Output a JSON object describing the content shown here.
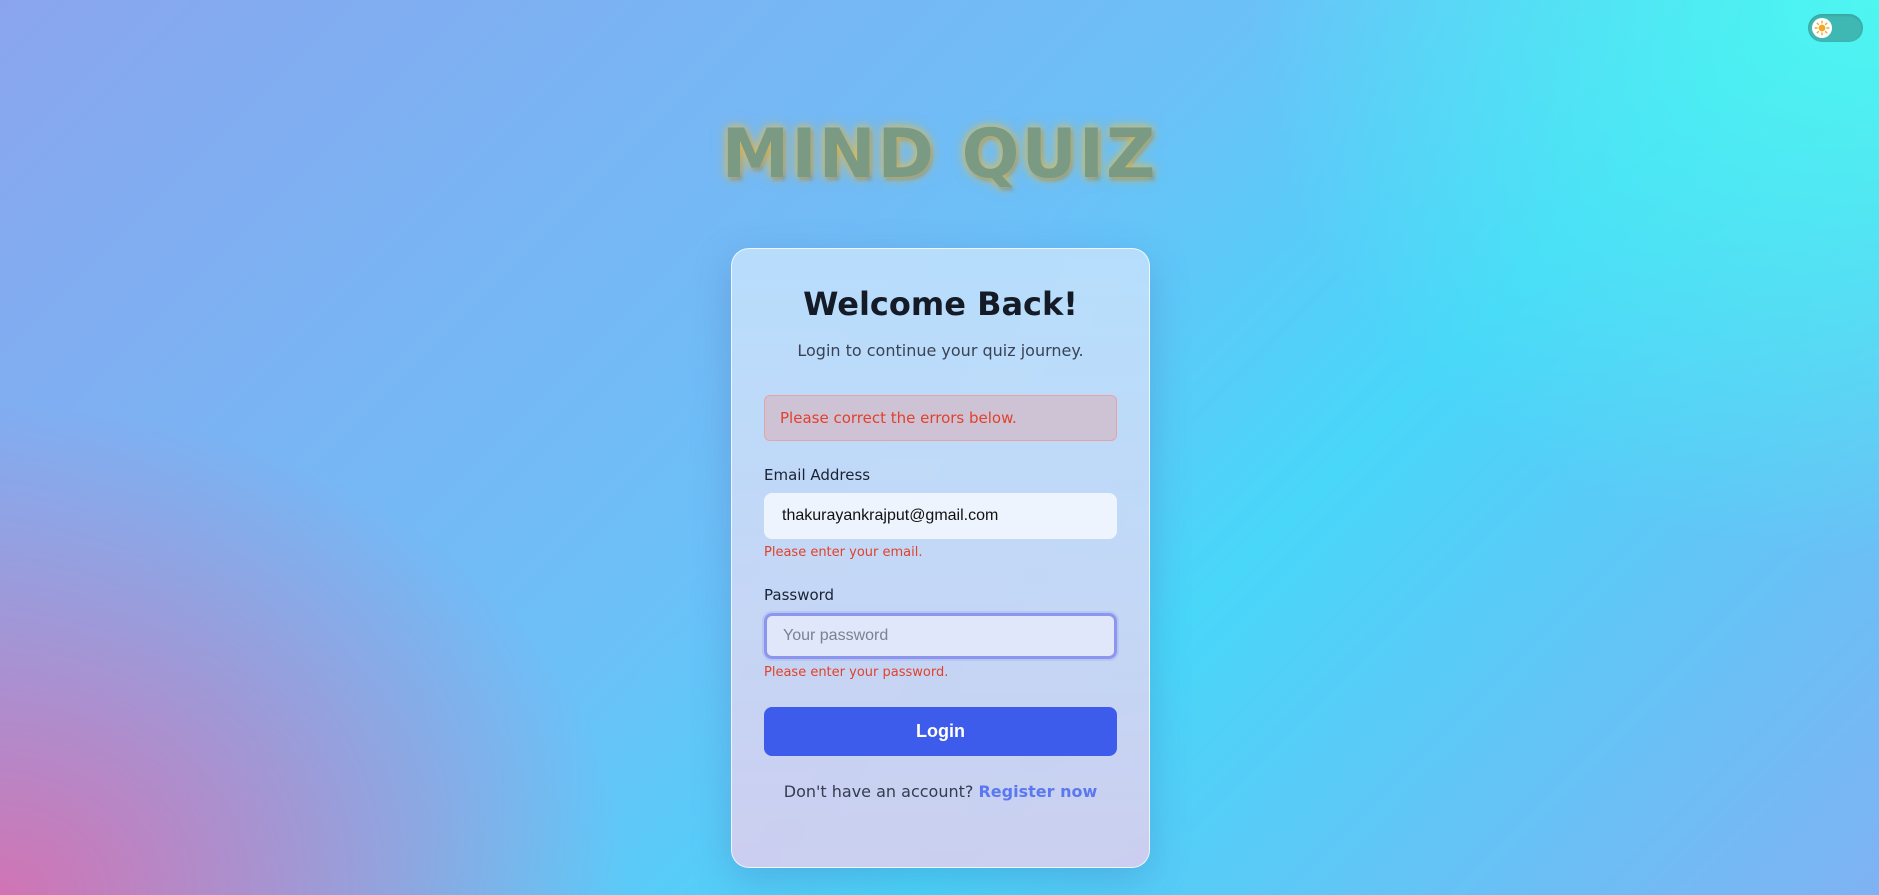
{
  "theme_toggle": {
    "icon": "sun-icon",
    "track_color": "#3fb8b4",
    "sun_color": "#f5a623"
  },
  "brand": {
    "title": "MIND QUIZ"
  },
  "card": {
    "title": "Welcome Back!",
    "subtitle": "Login to continue your quiz journey.",
    "alert": "Please correct the errors below.",
    "email": {
      "label": "Email Address",
      "value": "thakurayankrajput@gmail.com",
      "error": "Please enter your email."
    },
    "password": {
      "label": "Password",
      "placeholder": "Your password",
      "value": "",
      "error": "Please enter your password."
    },
    "login_button": "Login",
    "register_prompt": "Don't have an account?",
    "register_link": "Register now"
  },
  "colors": {
    "primary": "#3e5cec",
    "link": "#5b78f0",
    "error": "#e2412a"
  }
}
